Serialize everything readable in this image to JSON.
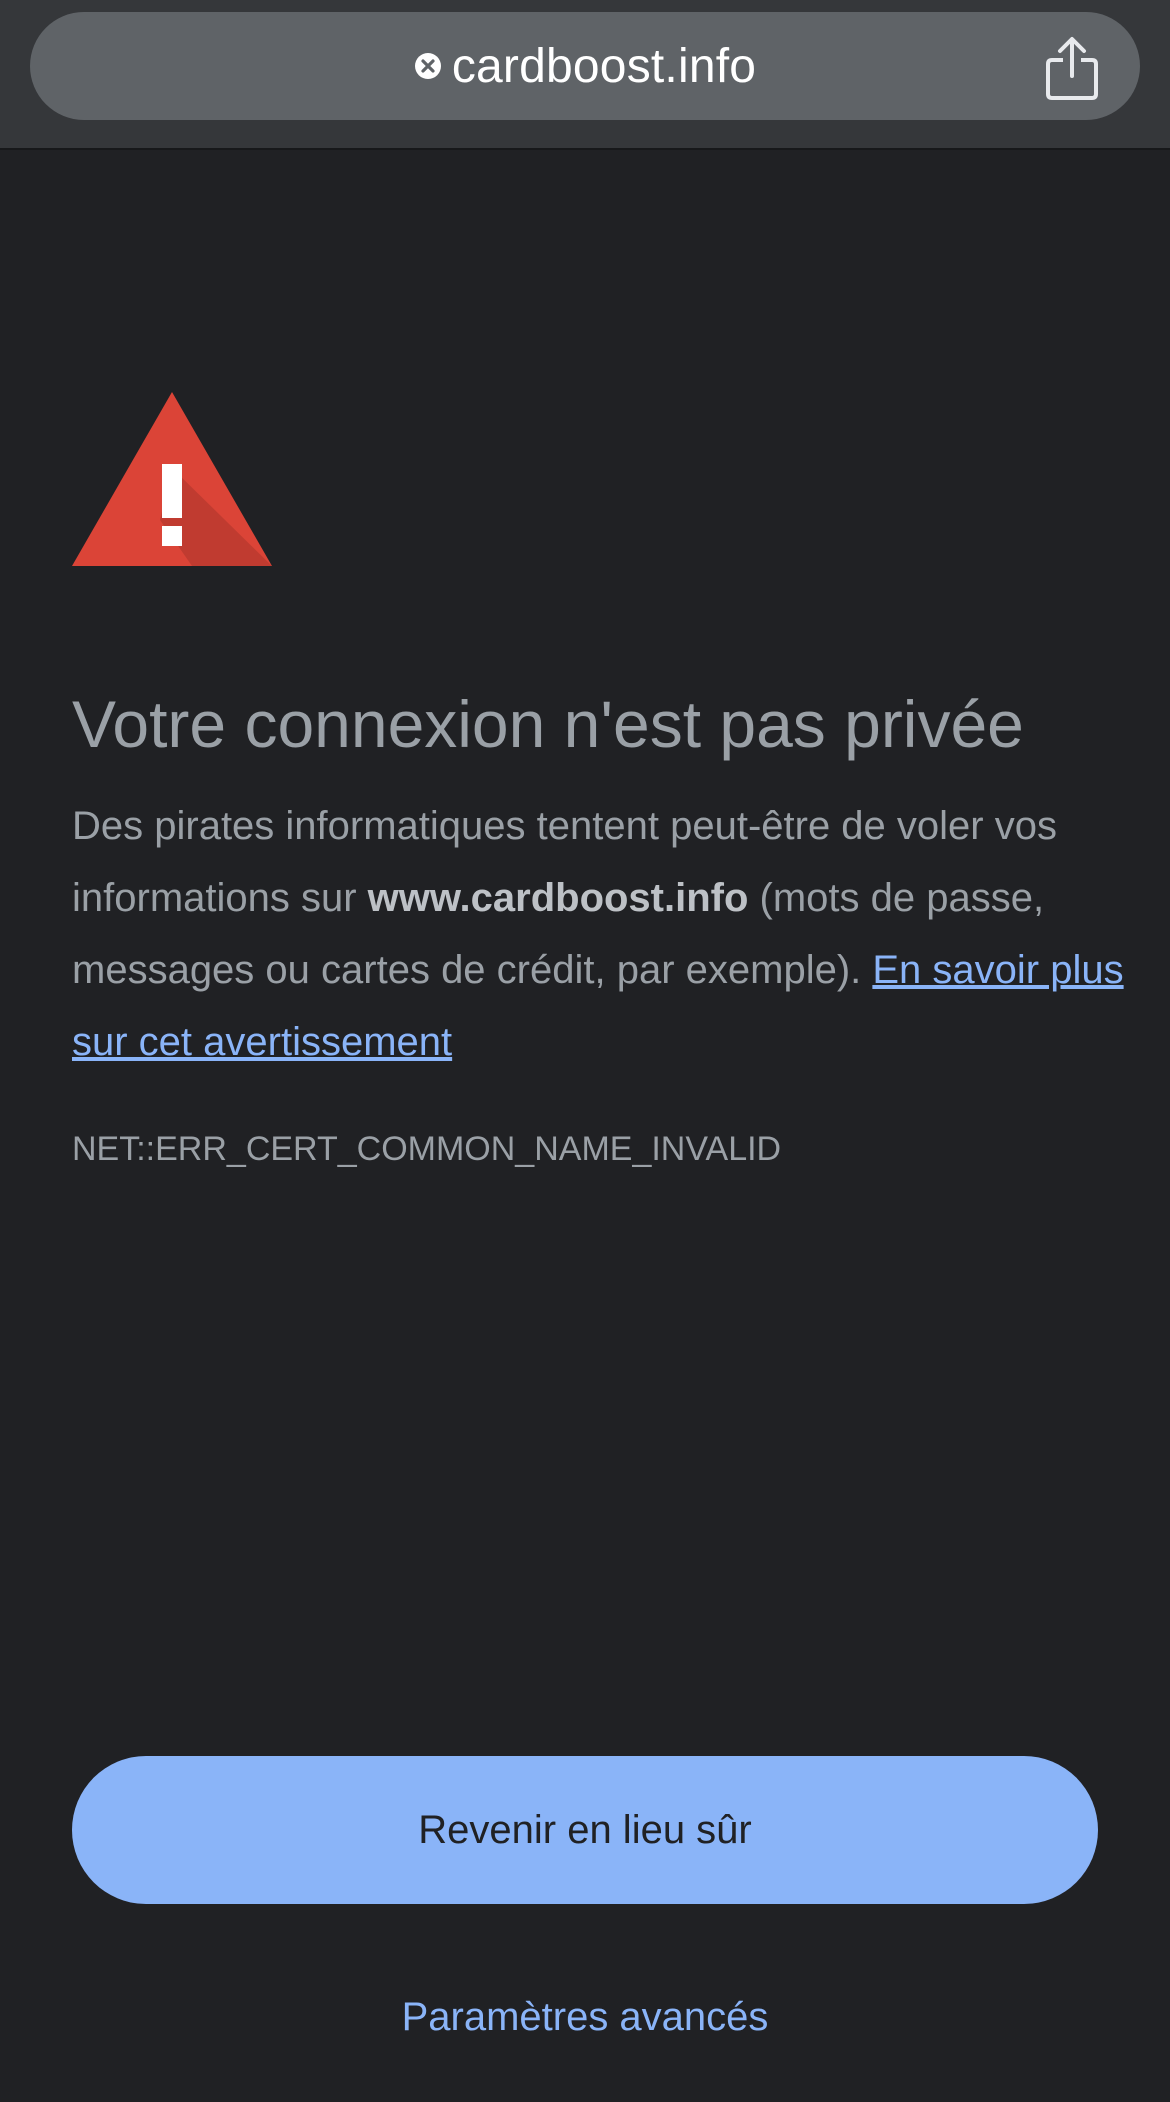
{
  "address_bar": {
    "security_icon": "insecure-x-icon",
    "url": "cardboost.info",
    "share_icon": "share-icon"
  },
  "interstitial": {
    "warning_icon": "warning-triangle-icon",
    "title": "Votre connexion n'est pas privée",
    "body_before_domain": "Des pirates informatiques tentent peut-être de voler vos informations sur ",
    "domain": "www.cardboost.info",
    "body_after_domain": " (mots de passe, messages ou cartes de crédit, par exemple). ",
    "learn_more_link": "En savoir plus sur cet avertissement",
    "error_code": "NET::ERR_CERT_COMMON_NAME_INVALID",
    "primary_button": "Revenir en lieu sûr",
    "secondary_button": "Paramètres avancés"
  },
  "colors": {
    "background": "#202124",
    "toolbar": "#35373a",
    "url_pill": "#5f6367",
    "text_secondary": "#9aa0a6",
    "accent_blue": "#8ab4f8",
    "warning_red": "#db4437"
  }
}
